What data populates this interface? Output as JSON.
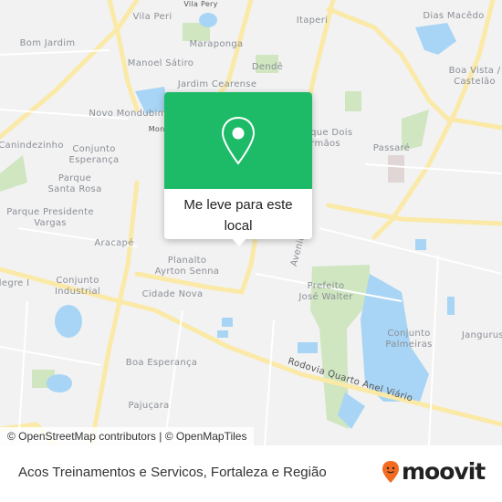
{
  "map": {
    "labels": {
      "vila_pery": "Vila Pery",
      "vila_peri": "Vila Peri",
      "itaperi": "Itaperi",
      "dias_macedo": "Dias Macêdo",
      "bom_jardim": "Bom Jardim",
      "maraponga": "Maraponga",
      "manoel_satiro": "Manoel Sátiro",
      "dende": "Dendê",
      "boa_vista_1": "Boa Vista /",
      "boa_vista_2": "Castelão",
      "jardim_cearense": "Jardim Cearense",
      "novo_mondubim": "Novo Mondubim",
      "mondubim": "Mondubim",
      "dois_irmaos_1": "Parque Dois",
      "dois_irmaos_2": "Irmãos",
      "canindezinho": "Canindezinho",
      "conj_esperanca_1": "Conjunto",
      "conj_esperanca_2": "Esperança",
      "passare": "Passaré",
      "santa_rosa_1": "Parque",
      "santa_rosa_2": "Santa Rosa",
      "pres_vargas_1": "Parque Presidente",
      "pres_vargas_2": "Vargas",
      "aracape": "Aracapé",
      "planalto_1": "Planalto",
      "planalto_2": "Ayrton Senna",
      "alegre": "Alegre I",
      "conj_industrial_1": "Conjunto",
      "conj_industrial_2": "Industrial",
      "cidade_nova": "Cidade Nova",
      "avenida": "Avenida",
      "jose_walter_1": "Prefeito",
      "jose_walter_2": "José Walter",
      "palmeiras_1": "Conjunto",
      "palmeiras_2": "Palmeiras",
      "jangurussu": "Jangurussu",
      "boa_esperanca": "Boa Esperança",
      "pajucara": "Pajuçara",
      "anel_viario": "Rodovia Quarto Anel Viário"
    },
    "attribution": "© OpenStreetMap contributors | © OpenMapTiles"
  },
  "popup": {
    "icon": "map-pin-icon",
    "label": "Me leve para este local",
    "color": "#1dbb68"
  },
  "footer": {
    "title": "Acos Treinamentos e Servicos, Fortaleza e Região",
    "logo_text": "moovit",
    "logo_color": "#f26b21"
  }
}
